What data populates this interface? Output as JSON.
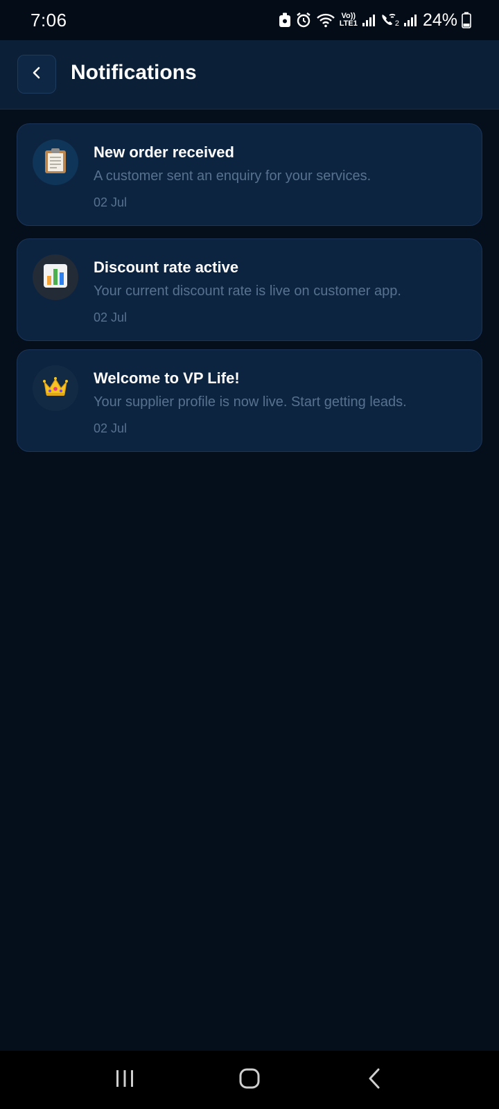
{
  "status_bar": {
    "time": "7:06",
    "battery": "24%",
    "network_label_top": "Vo))",
    "network_label_bottom": "LTE1",
    "sim2_label": "2"
  },
  "header": {
    "title": "Notifications",
    "back_icon": "chevron-left-icon"
  },
  "notifications": [
    {
      "title": "New order received",
      "body": "A customer sent an enquiry for your services.",
      "date": "02 Jul",
      "icon": "clipboard-icon",
      "icon_bg": "#0f3558"
    },
    {
      "title": "Discount rate active",
      "body": "Your current discount rate is live on customer app.",
      "date": "02 Jul",
      "icon": "bar-chart-icon",
      "icon_bg": "#232b36"
    },
    {
      "title": "Welcome to VP Life!",
      "body": "Your supplier profile is now live. Start getting leads.",
      "date": "02 Jul",
      "icon": "crown-icon",
      "icon_bg": "#132a44"
    }
  ],
  "nav_bar": {
    "recents_icon": "recents-icon",
    "home_icon": "home-icon",
    "back_icon": "back-icon"
  },
  "colors": {
    "background": "#050f1c",
    "header_bg": "#0b1f37",
    "card_bg": "#0d2441",
    "card_border": "#1a3558",
    "muted_text": "#56728f"
  }
}
